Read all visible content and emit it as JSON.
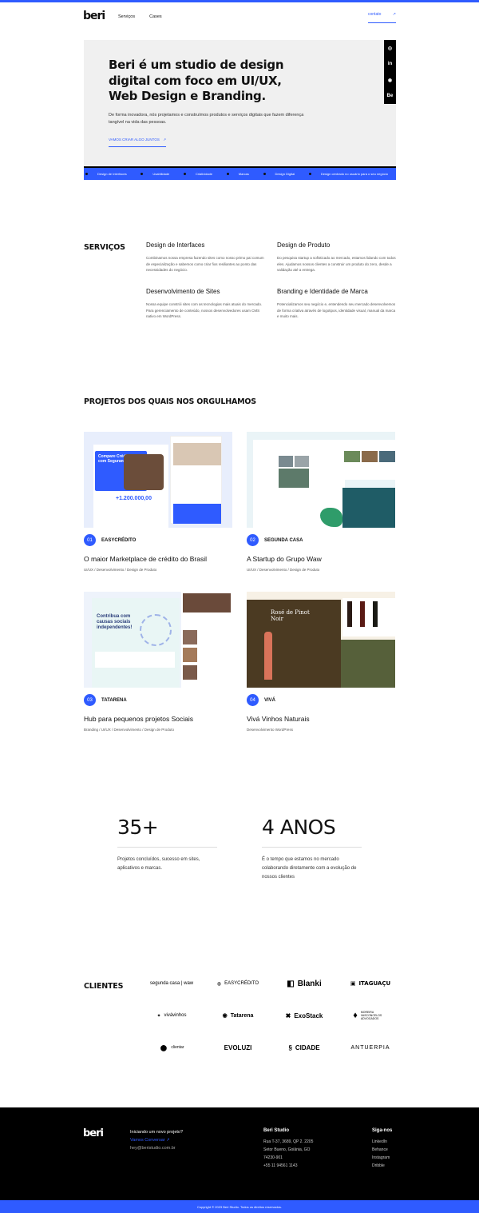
{
  "header": {
    "logo": "beri",
    "nav": [
      "Serviços",
      "Cases"
    ],
    "contact": "contato",
    "contact_arrow": "↗"
  },
  "hero": {
    "title": "Beri é um studio de design digital com foco em UI/UX, Web Design e Branding.",
    "text": "De forma inovadora, nós projetamos e construímos produtos e serviços digitais que fazem diferença tangível na vida das pessoas.",
    "cta": "VAMOS CRIAR ALGO JUNTOS",
    "cta_arrow": "↗",
    "social": [
      "◎",
      "in",
      "◉",
      "Be"
    ],
    "ticker": [
      "Design de Interfaces",
      "Usabilidade",
      "Criatividade",
      "Marcas",
      "Design Digital",
      "Design centrado no usuário para o seu negócio"
    ]
  },
  "services": {
    "title": "SERVIÇOS",
    "items": [
      {
        "title": "Design de Interfaces",
        "text": "Combinamos nossa empresa fazendo sites como nosso primo pai comum de especialização e sabemos como criar fios resiliantes ao ponto das necessidades do negócio."
      },
      {
        "title": "Design de Produto",
        "text": "Do pesquisa startup a sofisticado ao mercado, estamos lidando com todos eles. Ajudamos nossos clientes a construir um produto do zero, desde a validação até a entrega."
      },
      {
        "title": "Desenvolvimento de Sites",
        "text": "Nossa equipe constrói sites com as tecnologias mais atuais do mercado. Para gerenciamento de conteúdo, nossos desenvolvedores usam CMS nativo em WordPress."
      },
      {
        "title": "Branding e Identidade de Marca",
        "text": "Potencializamos seu negócio e, entendendo seu mercado desenvolvemos de forma criativa através de logotipos, identidade visual, manual da marca e muito mais."
      }
    ]
  },
  "projects": {
    "title": "PROJETOS DOS QUAIS NOS ORGULHAMOS",
    "items": [
      {
        "num": "01",
        "name": "EASYCRÉDITO",
        "title": "O maior Marketplace de crédito do Brasil",
        "tags": "UI/UX / Desenvolvimento / Design de Produto",
        "img_text": "Compare Crédito com Segurança",
        "img_value": "+1.200.000,00"
      },
      {
        "num": "02",
        "name": "SEGUNDA CASA",
        "title": "A Startup do Grupo Waw",
        "tags": "UI/UX / Desenvolvimento / Design de Produto"
      },
      {
        "num": "03",
        "name": "TATARENA",
        "title": "Hub para pequenos projetos Sociais",
        "tags": "Branding / UI/UX / Desenvolvimento / Design de Produto",
        "img_text": "Contribua com causas sociais independentes!"
      },
      {
        "num": "04",
        "name": "VIVÁ",
        "title": "Vivá Vinhos Naturais",
        "tags": "Desenvolvimento WordPress",
        "img_text": "Rosé de Pinot Noir"
      }
    ]
  },
  "stats": [
    {
      "big": "35+",
      "text": "Projetos concluídos, sucesso em sites, aplicativos e marcas."
    },
    {
      "big": "4 ANOS",
      "text": "É o tempo que estamos no mercado colaborando diretamente com a evolução de nossos clientes"
    }
  ],
  "clients": {
    "title": "CLIENTES",
    "logos": [
      "segunda casa | waw",
      "EASYCRÉDITO",
      "Blanki",
      "ITAGUAÇU",
      "vivávinhos",
      "Tatarena",
      "ExoStack",
      "MOREIRA VASCONCELOS ADVOGADOS",
      "clientar",
      "EVOLUZI",
      "CIDADE",
      "ANTUERPIA"
    ]
  },
  "footer": {
    "logo": "beri",
    "cta_q": "Iniciando um novo projeto?",
    "cta_link": "Vamos Conversar ↗",
    "email": "hey@beristudio.com.br",
    "studio_title": "Beri Studio",
    "address": [
      "Rua T-37, 3689, QP 2. 2205",
      "Setor Bueno, Goiânia, GO",
      "74230-901",
      "+55 11 94561 1143"
    ],
    "social_title": "Siga-nos",
    "social": [
      "LinkedIn",
      "Behance",
      "Instagram",
      "Dribble"
    ],
    "copyright": "Copyright © 2023 Beri Studio. Todos os direitos reservados."
  }
}
